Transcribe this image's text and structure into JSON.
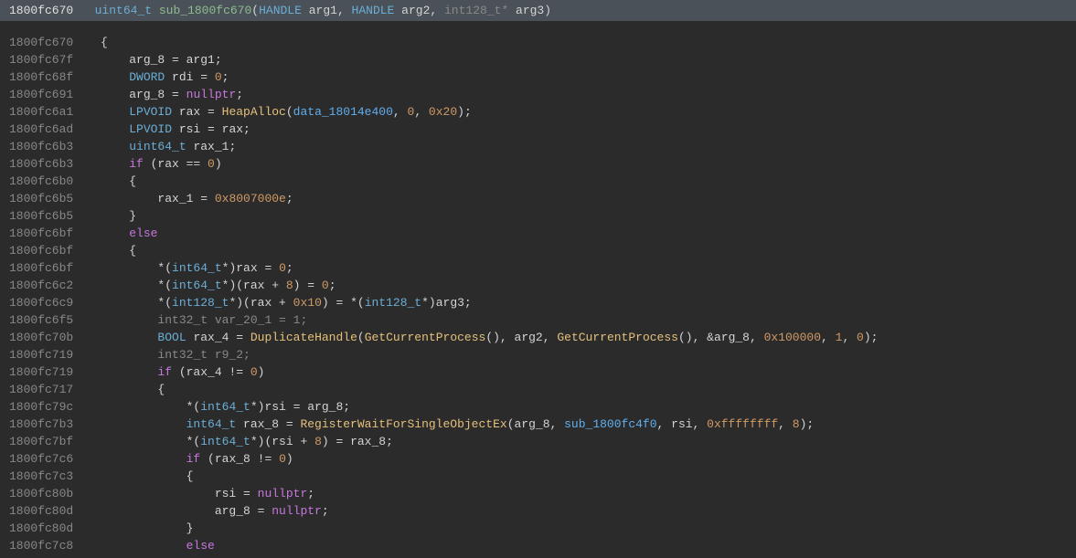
{
  "header": {
    "addr": "1800fc670",
    "ret_type": "uint64_t",
    "func_name": "sub_1800fc670",
    "param1_type": "HANDLE",
    "param1_name": "arg1",
    "param2_type": "HANDLE",
    "param2_name": "arg2",
    "param3_type": "int128_t",
    "param3_name": "arg3"
  },
  "lines": [
    {
      "addr": "1800fc670",
      "indent": 0,
      "tokens": [
        {
          "t": "brace",
          "v": "{"
        }
      ]
    },
    {
      "addr": "1800fc67f",
      "indent": 1,
      "tokens": [
        {
          "t": "var",
          "v": "arg_8 = arg1;"
        }
      ]
    },
    {
      "addr": "1800fc68f",
      "indent": 1,
      "tokens": [
        {
          "t": "type",
          "v": "DWORD"
        },
        {
          "t": "var",
          "v": " rdi = "
        },
        {
          "t": "number",
          "v": "0"
        },
        {
          "t": "var",
          "v": ";"
        }
      ]
    },
    {
      "addr": "1800fc691",
      "indent": 1,
      "tokens": [
        {
          "t": "var",
          "v": "arg_8 = "
        },
        {
          "t": "keyword",
          "v": "nullptr"
        },
        {
          "t": "var",
          "v": ";"
        }
      ]
    },
    {
      "addr": "1800fc6a1",
      "indent": 1,
      "tokens": [
        {
          "t": "type",
          "v": "LPVOID"
        },
        {
          "t": "var",
          "v": " rax = "
        },
        {
          "t": "call",
          "v": "HeapAlloc"
        },
        {
          "t": "var",
          "v": "("
        },
        {
          "t": "ident",
          "v": "data_18014e400"
        },
        {
          "t": "var",
          "v": ", "
        },
        {
          "t": "number",
          "v": "0"
        },
        {
          "t": "var",
          "v": ", "
        },
        {
          "t": "number",
          "v": "0x20"
        },
        {
          "t": "var",
          "v": ");"
        }
      ]
    },
    {
      "addr": "1800fc6ad",
      "indent": 1,
      "tokens": [
        {
          "t": "type",
          "v": "LPVOID"
        },
        {
          "t": "var",
          "v": " rsi = rax;"
        }
      ]
    },
    {
      "addr": "1800fc6b3",
      "indent": 1,
      "tokens": [
        {
          "t": "type",
          "v": "uint64_t"
        },
        {
          "t": "var",
          "v": " rax_1;"
        }
      ]
    },
    {
      "addr": "1800fc6b3",
      "indent": 1,
      "tokens": [
        {
          "t": "keyword",
          "v": "if"
        },
        {
          "t": "var",
          "v": " (rax == "
        },
        {
          "t": "number",
          "v": "0"
        },
        {
          "t": "var",
          "v": ")"
        }
      ]
    },
    {
      "addr": "1800fc6b0",
      "indent": 1,
      "tokens": [
        {
          "t": "brace",
          "v": "{"
        }
      ]
    },
    {
      "addr": "1800fc6b5",
      "indent": 2,
      "tokens": [
        {
          "t": "var",
          "v": "rax_1 = "
        },
        {
          "t": "number",
          "v": "0x8007000e"
        },
        {
          "t": "var",
          "v": ";"
        }
      ]
    },
    {
      "addr": "1800fc6b5",
      "indent": 1,
      "tokens": [
        {
          "t": "brace",
          "v": "}"
        }
      ]
    },
    {
      "addr": "1800fc6bf",
      "indent": 1,
      "tokens": [
        {
          "t": "keyword",
          "v": "else"
        }
      ]
    },
    {
      "addr": "1800fc6bf",
      "indent": 1,
      "tokens": [
        {
          "t": "brace",
          "v": "{"
        }
      ]
    },
    {
      "addr": "1800fc6bf",
      "indent": 2,
      "tokens": [
        {
          "t": "var",
          "v": "*("
        },
        {
          "t": "type",
          "v": "int64_t"
        },
        {
          "t": "var",
          "v": "*)rax = "
        },
        {
          "t": "number",
          "v": "0"
        },
        {
          "t": "var",
          "v": ";"
        }
      ]
    },
    {
      "addr": "1800fc6c2",
      "indent": 2,
      "tokens": [
        {
          "t": "var",
          "v": "*("
        },
        {
          "t": "type",
          "v": "int64_t"
        },
        {
          "t": "var",
          "v": "*)(rax + "
        },
        {
          "t": "number",
          "v": "8"
        },
        {
          "t": "var",
          "v": ") = "
        },
        {
          "t": "number",
          "v": "0"
        },
        {
          "t": "var",
          "v": ";"
        }
      ]
    },
    {
      "addr": "1800fc6c9",
      "indent": 2,
      "tokens": [
        {
          "t": "var",
          "v": "*("
        },
        {
          "t": "type",
          "v": "int128_t"
        },
        {
          "t": "var",
          "v": "*)(rax + "
        },
        {
          "t": "number",
          "v": "0x10"
        },
        {
          "t": "var",
          "v": ") = *("
        },
        {
          "t": "type",
          "v": "int128_t"
        },
        {
          "t": "var",
          "v": "*)arg3;"
        }
      ]
    },
    {
      "addr": "1800fc6f5",
      "indent": 2,
      "tokens": [
        {
          "t": "comment-type",
          "v": "int32_t var_20_1 = 1;"
        }
      ]
    },
    {
      "addr": "1800fc70b",
      "indent": 2,
      "tokens": [
        {
          "t": "type",
          "v": "BOOL"
        },
        {
          "t": "var",
          "v": " rax_4 = "
        },
        {
          "t": "call",
          "v": "DuplicateHandle"
        },
        {
          "t": "var",
          "v": "("
        },
        {
          "t": "call",
          "v": "GetCurrentProcess"
        },
        {
          "t": "var",
          "v": "(), arg2, "
        },
        {
          "t": "call",
          "v": "GetCurrentProcess"
        },
        {
          "t": "var",
          "v": "(), &arg_8, "
        },
        {
          "t": "number",
          "v": "0x100000"
        },
        {
          "t": "var",
          "v": ", "
        },
        {
          "t": "number",
          "v": "1"
        },
        {
          "t": "var",
          "v": ", "
        },
        {
          "t": "number",
          "v": "0"
        },
        {
          "t": "var",
          "v": ");"
        }
      ]
    },
    {
      "addr": "1800fc719",
      "indent": 2,
      "tokens": [
        {
          "t": "comment-type",
          "v": "int32_t r9_2;"
        }
      ]
    },
    {
      "addr": "1800fc719",
      "indent": 2,
      "tokens": [
        {
          "t": "keyword",
          "v": "if"
        },
        {
          "t": "var",
          "v": " (rax_4 != "
        },
        {
          "t": "number",
          "v": "0"
        },
        {
          "t": "var",
          "v": ")"
        }
      ]
    },
    {
      "addr": "1800fc717",
      "indent": 2,
      "tokens": [
        {
          "t": "brace",
          "v": "{"
        }
      ]
    },
    {
      "addr": "1800fc79c",
      "indent": 3,
      "tokens": [
        {
          "t": "var",
          "v": "*("
        },
        {
          "t": "type",
          "v": "int64_t"
        },
        {
          "t": "var",
          "v": "*)rsi = arg_8;"
        }
      ]
    },
    {
      "addr": "1800fc7b3",
      "indent": 3,
      "tokens": [
        {
          "t": "type",
          "v": "int64_t"
        },
        {
          "t": "var",
          "v": " rax_8 = "
        },
        {
          "t": "call",
          "v": "RegisterWaitForSingleObjectEx"
        },
        {
          "t": "var",
          "v": "(arg_8, "
        },
        {
          "t": "ident",
          "v": "sub_1800fc4f0"
        },
        {
          "t": "var",
          "v": ", rsi, "
        },
        {
          "t": "number",
          "v": "0xffffffff"
        },
        {
          "t": "var",
          "v": ", "
        },
        {
          "t": "number",
          "v": "8"
        },
        {
          "t": "var",
          "v": ");"
        }
      ]
    },
    {
      "addr": "1800fc7bf",
      "indent": 3,
      "tokens": [
        {
          "t": "var",
          "v": "*("
        },
        {
          "t": "type",
          "v": "int64_t"
        },
        {
          "t": "var",
          "v": "*)(rsi + "
        },
        {
          "t": "number",
          "v": "8"
        },
        {
          "t": "var",
          "v": ") = rax_8;"
        }
      ]
    },
    {
      "addr": "1800fc7c6",
      "indent": 3,
      "tokens": [
        {
          "t": "keyword",
          "v": "if"
        },
        {
          "t": "var",
          "v": " (rax_8 != "
        },
        {
          "t": "number",
          "v": "0"
        },
        {
          "t": "var",
          "v": ")"
        }
      ]
    },
    {
      "addr": "1800fc7c3",
      "indent": 3,
      "tokens": [
        {
          "t": "brace",
          "v": "{"
        }
      ]
    },
    {
      "addr": "1800fc80b",
      "indent": 4,
      "tokens": [
        {
          "t": "var",
          "v": "rsi = "
        },
        {
          "t": "keyword",
          "v": "nullptr"
        },
        {
          "t": "var",
          "v": ";"
        }
      ]
    },
    {
      "addr": "1800fc80d",
      "indent": 4,
      "tokens": [
        {
          "t": "var",
          "v": "arg_8 = "
        },
        {
          "t": "keyword",
          "v": "nullptr"
        },
        {
          "t": "var",
          "v": ";"
        }
      ]
    },
    {
      "addr": "1800fc80d",
      "indent": 3,
      "tokens": [
        {
          "t": "brace",
          "v": "}"
        }
      ]
    },
    {
      "addr": "1800fc7c8",
      "indent": 3,
      "tokens": [
        {
          "t": "keyword",
          "v": "else"
        }
      ]
    }
  ]
}
